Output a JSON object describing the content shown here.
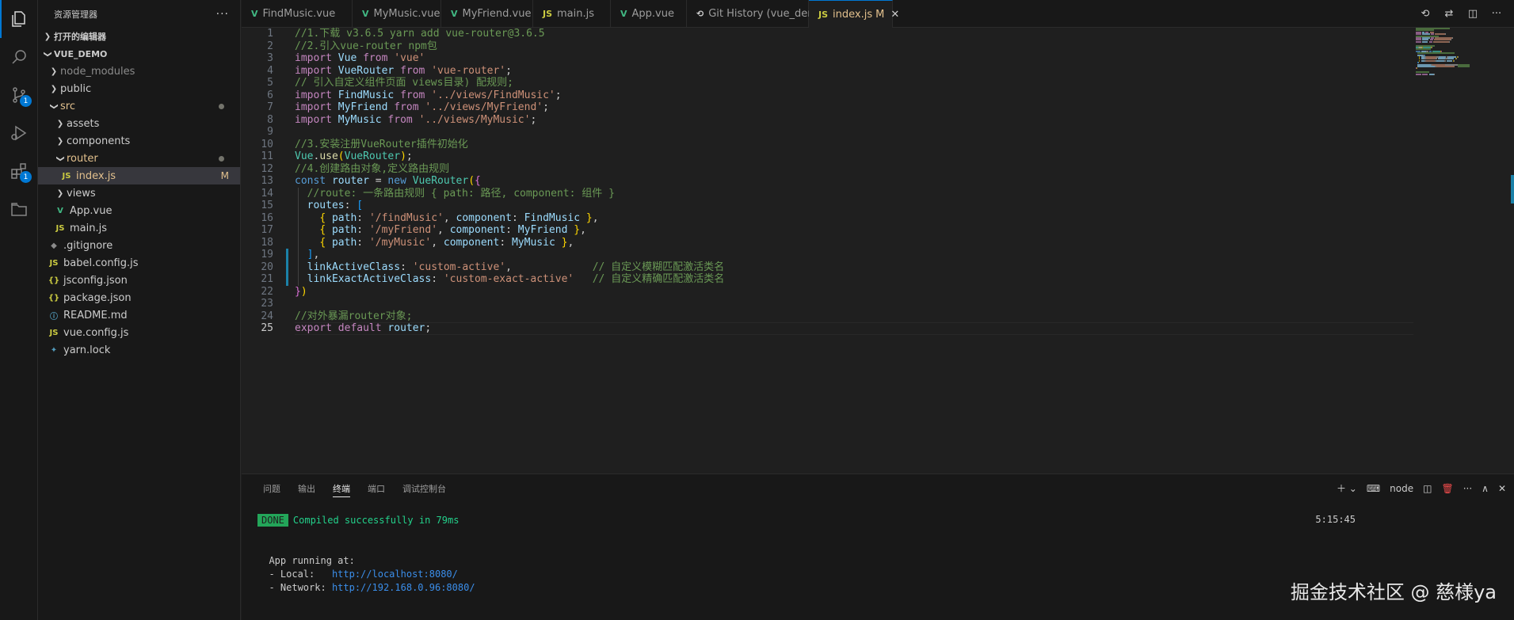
{
  "activity_bar": {
    "items": [
      {
        "name": "explorer-icon",
        "badge": ""
      },
      {
        "name": "search-icon",
        "badge": ""
      },
      {
        "name": "source-control-icon",
        "badge": "1"
      },
      {
        "name": "run-debug-icon",
        "badge": ""
      },
      {
        "name": "extensions-icon",
        "badge": "1"
      },
      {
        "name": "remote-explorer-icon",
        "badge": ""
      }
    ]
  },
  "sidebar": {
    "title": "资源管理器",
    "open_editors": "打开的编辑器",
    "project": "VUE_DEMO",
    "tree": [
      {
        "label": "node_modules",
        "kind": "folder",
        "depth": 1,
        "open": false,
        "dim": true
      },
      {
        "label": "public",
        "kind": "folder",
        "depth": 1,
        "open": false
      },
      {
        "label": "src",
        "kind": "folder",
        "depth": 1,
        "open": true,
        "dot": true
      },
      {
        "label": "assets",
        "kind": "folder",
        "depth": 2,
        "open": false
      },
      {
        "label": "components",
        "kind": "folder",
        "depth": 2,
        "open": false
      },
      {
        "label": "router",
        "kind": "folder",
        "depth": 2,
        "open": true,
        "dot": true
      },
      {
        "label": "index.js",
        "kind": "js",
        "depth": 3,
        "selected": true,
        "mod": "M"
      },
      {
        "label": "views",
        "kind": "folder",
        "depth": 2,
        "open": false
      },
      {
        "label": "App.vue",
        "kind": "vue",
        "depth": 2
      },
      {
        "label": "main.js",
        "kind": "js",
        "depth": 2
      },
      {
        "label": ".gitignore",
        "kind": "git",
        "depth": 1
      },
      {
        "label": "babel.config.js",
        "kind": "babel",
        "depth": 1
      },
      {
        "label": "jsconfig.json",
        "kind": "json",
        "depth": 1
      },
      {
        "label": "package.json",
        "kind": "json",
        "depth": 1
      },
      {
        "label": "README.md",
        "kind": "info",
        "depth": 1
      },
      {
        "label": "vue.config.js",
        "kind": "js",
        "depth": 1
      },
      {
        "label": "yarn.lock",
        "kind": "yarn",
        "depth": 1
      }
    ]
  },
  "tabs": [
    {
      "label": "FindMusic.vue",
      "icon": "vue"
    },
    {
      "label": "MyMusic.vue",
      "icon": "vue"
    },
    {
      "label": "MyFriend.vue",
      "icon": "vue"
    },
    {
      "label": "main.js",
      "icon": "js"
    },
    {
      "label": "App.vue",
      "icon": "vue"
    },
    {
      "label": "Git History (vue_demo)",
      "icon": "history"
    },
    {
      "label": "index.js",
      "icon": "js",
      "active": true,
      "mod": "M"
    }
  ],
  "editor": {
    "current_line": 25,
    "lines": [
      [
        [
          "cm",
          "//1.下载 v3.6.5 yarn add vue-router@3.6.5"
        ]
      ],
      [
        [
          "cm",
          "//2.引入vue-router npm包"
        ]
      ],
      [
        [
          "kw",
          "import"
        ],
        [
          "p",
          " "
        ],
        [
          "id",
          "Vue"
        ],
        [
          "p",
          " "
        ],
        [
          "kw",
          "from"
        ],
        [
          "p",
          " "
        ],
        [
          "str",
          "'vue'"
        ]
      ],
      [
        [
          "kw",
          "import"
        ],
        [
          "p",
          " "
        ],
        [
          "id",
          "VueRouter"
        ],
        [
          "p",
          " "
        ],
        [
          "kw",
          "from"
        ],
        [
          "p",
          " "
        ],
        [
          "str",
          "'vue-router'"
        ],
        [
          "p",
          ";"
        ]
      ],
      [
        [
          "cm",
          "// 引入自定义组件页面 views目录) 配规则;"
        ]
      ],
      [
        [
          "kw",
          "import"
        ],
        [
          "p",
          " "
        ],
        [
          "id",
          "FindMusic"
        ],
        [
          "p",
          " "
        ],
        [
          "kw",
          "from"
        ],
        [
          "p",
          " "
        ],
        [
          "str",
          "'../views/FindMusic'"
        ],
        [
          "p",
          ";"
        ]
      ],
      [
        [
          "kw",
          "import"
        ],
        [
          "p",
          " "
        ],
        [
          "id",
          "MyFriend"
        ],
        [
          "p",
          " "
        ],
        [
          "kw",
          "from"
        ],
        [
          "p",
          " "
        ],
        [
          "str",
          "'../views/MyFriend'"
        ],
        [
          "p",
          ";"
        ]
      ],
      [
        [
          "kw",
          "import"
        ],
        [
          "p",
          " "
        ],
        [
          "id",
          "MyMusic"
        ],
        [
          "p",
          " "
        ],
        [
          "kw",
          "from"
        ],
        [
          "p",
          " "
        ],
        [
          "str",
          "'../views/MyMusic'"
        ],
        [
          "p",
          ";"
        ]
      ],
      [],
      [
        [
          "cm",
          "//3.安装注册VueRouter插件初始化"
        ]
      ],
      [
        [
          "cls",
          "Vue"
        ],
        [
          "p",
          "."
        ],
        [
          "fn",
          "use"
        ],
        [
          "b1",
          "("
        ],
        [
          "cls",
          "VueRouter"
        ],
        [
          "b1",
          ")"
        ],
        [
          "p",
          ";"
        ]
      ],
      [
        [
          "cm",
          "//4.创建路由对象,定义路由规则"
        ]
      ],
      [
        [
          "blue",
          "const"
        ],
        [
          "p",
          " "
        ],
        [
          "id",
          "router"
        ],
        [
          "p",
          " = "
        ],
        [
          "blue",
          "new"
        ],
        [
          "p",
          " "
        ],
        [
          "cls",
          "VueRouter"
        ],
        [
          "b1",
          "("
        ],
        [
          "b2",
          "{"
        ]
      ],
      [
        [
          "p",
          "  "
        ],
        [
          "cm",
          "//route: 一条路由规则 { path: 路径, component: 组件 }"
        ]
      ],
      [
        [
          "p",
          "  "
        ],
        [
          "id",
          "routes"
        ],
        [
          "p",
          ": "
        ],
        [
          "b3",
          "["
        ]
      ],
      [
        [
          "p",
          "    "
        ],
        [
          "b1",
          "{"
        ],
        [
          "p",
          " "
        ],
        [
          "id",
          "path"
        ],
        [
          "p",
          ": "
        ],
        [
          "str",
          "'/findMusic'"
        ],
        [
          "p",
          ", "
        ],
        [
          "id",
          "component"
        ],
        [
          "p",
          ": "
        ],
        [
          "id",
          "FindMusic"
        ],
        [
          "p",
          " "
        ],
        [
          "b1",
          "}"
        ],
        [
          "p",
          ","
        ]
      ],
      [
        [
          "p",
          "    "
        ],
        [
          "b1",
          "{"
        ],
        [
          "p",
          " "
        ],
        [
          "id",
          "path"
        ],
        [
          "p",
          ": "
        ],
        [
          "str",
          "'/myFriend'"
        ],
        [
          "p",
          ", "
        ],
        [
          "id",
          "component"
        ],
        [
          "p",
          ": "
        ],
        [
          "id",
          "MyFriend"
        ],
        [
          "p",
          " "
        ],
        [
          "b1",
          "}"
        ],
        [
          "p",
          ","
        ]
      ],
      [
        [
          "p",
          "    "
        ],
        [
          "b1",
          "{"
        ],
        [
          "p",
          " "
        ],
        [
          "id",
          "path"
        ],
        [
          "p",
          ": "
        ],
        [
          "str",
          "'/myMusic'"
        ],
        [
          "p",
          ", "
        ],
        [
          "id",
          "component"
        ],
        [
          "p",
          ": "
        ],
        [
          "id",
          "MyMusic"
        ],
        [
          "p",
          " "
        ],
        [
          "b1",
          "}"
        ],
        [
          "p",
          ","
        ]
      ],
      [
        [
          "p",
          "  "
        ],
        [
          "b3",
          "]"
        ],
        [
          "p",
          ","
        ]
      ],
      [
        [
          "p",
          "  "
        ],
        [
          "id",
          "linkActiveClass"
        ],
        [
          "p",
          ": "
        ],
        [
          "str",
          "'custom-active'"
        ],
        [
          "p",
          ",             "
        ],
        [
          "cm",
          "// 自定义模糊匹配激活类名"
        ]
      ],
      [
        [
          "p",
          "  "
        ],
        [
          "id",
          "linkExactActiveClass"
        ],
        [
          "p",
          ": "
        ],
        [
          "str",
          "'custom-exact-active'"
        ],
        [
          "p",
          "   "
        ],
        [
          "cm",
          "// 自定义精确匹配激活类名"
        ]
      ],
      [
        [
          "b2",
          "}"
        ],
        [
          "b1",
          ")"
        ]
      ],
      [],
      [
        [
          "cm",
          "//对外暴漏router对象;"
        ]
      ],
      [
        [
          "kw",
          "export"
        ],
        [
          "p",
          " "
        ],
        [
          "kw",
          "default"
        ],
        [
          "p",
          " "
        ],
        [
          "id",
          "router"
        ],
        [
          "p",
          ";"
        ]
      ]
    ],
    "modified_lines": [
      19,
      20,
      21
    ]
  },
  "panel": {
    "tabs": [
      "问题",
      "输出",
      "终端",
      "端口",
      "调试控制台"
    ],
    "active_tab": 2,
    "shell_label": "node",
    "terminal": {
      "done": "DONE",
      "compiled": "Compiled successfully in 79ms",
      "time": "5:15:45",
      "running": "App running at:",
      "local_label": "- Local:   ",
      "local_url": "http://localhost:8080/",
      "network_label": "- Network: ",
      "network_url": "http://192.168.0.96:8080/"
    }
  },
  "watermark": "掘金技术社区 @ 慈様ya"
}
